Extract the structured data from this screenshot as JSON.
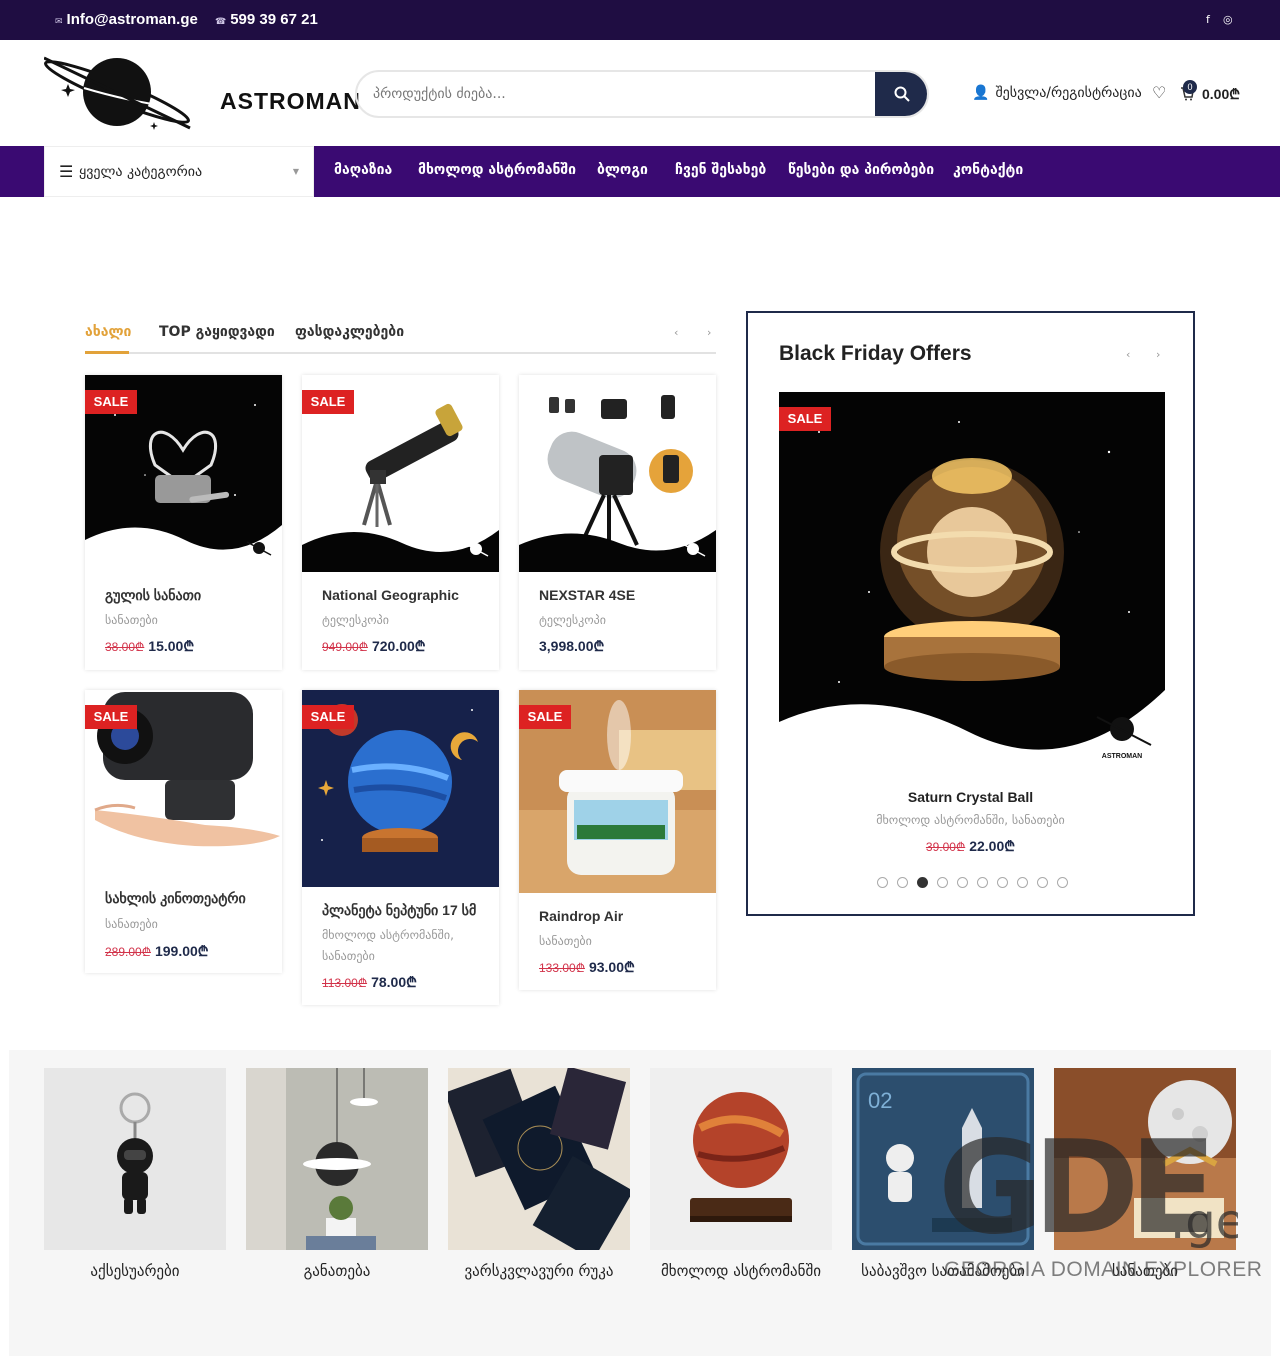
{
  "topbar": {
    "email": "Info@astroman.ge",
    "phone": "599 39 67 21",
    "email_icon": "mail-icon",
    "phone_icon": "phone-icon",
    "social": [
      "facebook-icon",
      "instagram-icon"
    ],
    "bg_color": "#1f0d42"
  },
  "header": {
    "logo_text": "ASTROMAN",
    "search_placeholder": "პროდუქტის ძიება...",
    "login_label": "შესვლა/რეგისტრაცია",
    "cart_count": "0",
    "cart_total": "0.00",
    "currency_symbol": "₾",
    "accent_color": "#1f2a4a"
  },
  "nav": {
    "all_categories": "ყველა კატეგორია",
    "links": [
      "მაღაზია",
      "მხოლოდ ასტრომანში",
      "ბლოგი",
      "ჩვენ შესახებ",
      "წესები და პირობები",
      "კონტაქტი"
    ],
    "bg_color": "#3a0a72"
  },
  "tabs": {
    "items": [
      "ახალი",
      "TOP გაყიდვადი",
      "ფასდაკლებები"
    ],
    "active": 0,
    "active_color": "#e2a23a"
  },
  "products": [
    {
      "title": "გულის სანათი",
      "category": "სანათები",
      "old_price": "38.00",
      "price": "15.00",
      "sale_label": "SALE"
    },
    {
      "title": "National Geographic",
      "category": "ტელესკოპი",
      "old_price": "949.00",
      "price": "720.00",
      "sale_label": "SALE"
    },
    {
      "title": "NEXSTAR 4SE",
      "category": "ტელესკოპი",
      "old_price": "",
      "price": "3,998.00",
      "sale_label": ""
    },
    {
      "title": "სახლის კინოთეატრი",
      "category": "სანათები",
      "old_price": "289.00",
      "price": "199.00",
      "sale_label": "SALE"
    },
    {
      "title": "პლანეტა ნეპტუნი 17 სმ",
      "category": "მხოლოდ ასტრომანში, სანათები",
      "old_price": "113.00",
      "price": "78.00",
      "sale_label": "SALE"
    },
    {
      "title": "Raindrop Air",
      "category": "სანათები",
      "old_price": "133.00",
      "price": "93.00",
      "sale_label": "SALE"
    }
  ],
  "black_friday": {
    "title": "Black Friday Offers",
    "sale_label": "SALE",
    "product_name": "Saturn Crystal Ball",
    "product_category": "მხოლოდ ასტრომანში, სანათები",
    "old_price": "39.00",
    "price": "22.00",
    "slide_count": 10,
    "active_slide": 3,
    "brand_label": "ASTROMAN"
  },
  "categories": [
    {
      "label": "აქსესუარები"
    },
    {
      "label": "განათება"
    },
    {
      "label": "ვარსკვლავური რუკა"
    },
    {
      "label": "მხოლოდ ასტრომანში"
    },
    {
      "label": "საბავშვო სათამაშოები"
    },
    {
      "label": "სანათები"
    }
  ],
  "watermark": {
    "text": "GEORGIA DOMAIN EXPLORER",
    "logo": "GDE.ge"
  }
}
